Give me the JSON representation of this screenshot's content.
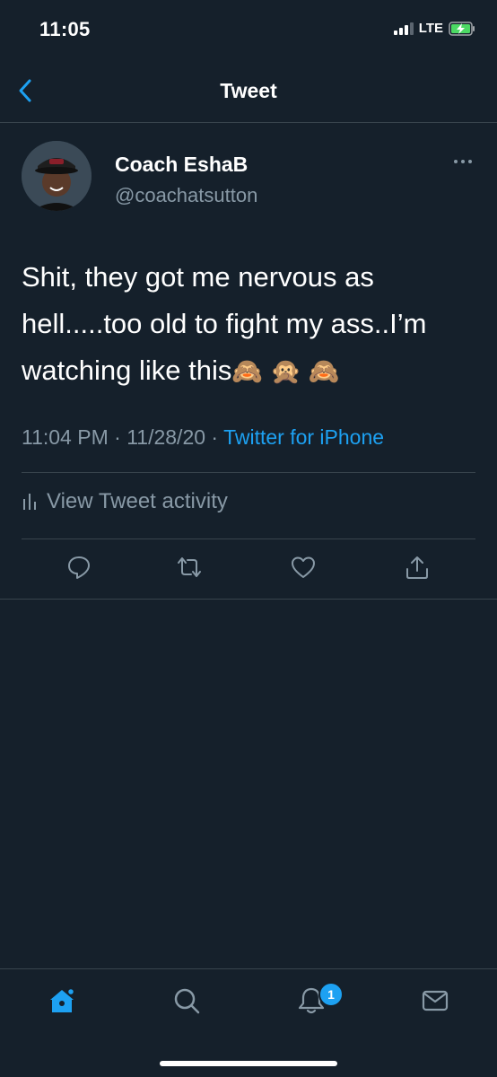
{
  "status_bar": {
    "time": "11:05",
    "network": "LTE"
  },
  "header": {
    "title": "Tweet"
  },
  "tweet": {
    "display_name": "Coach EshaB",
    "handle": "@coachatsutton",
    "text": "Shit, they got me nervous as hell.....too old to fight my ass..I’m watching like this",
    "emojis": "🙈 🙊 🙈",
    "time": "11:04 PM",
    "date": "11/28/20",
    "source": "Twitter for iPhone",
    "separator": "·"
  },
  "activity": {
    "label": "View Tweet activity"
  },
  "actions": {
    "icons": [
      "reply-icon",
      "retweet-icon",
      "like-icon",
      "share-icon"
    ]
  },
  "tab_bar": {
    "icons": [
      "home-icon",
      "search-icon",
      "notifications-icon",
      "messages-icon"
    ],
    "notification_count": "1"
  },
  "colors": {
    "background": "#15202b",
    "accent": "#1da1f2",
    "secondary_text": "#8899a6",
    "divider": "#38444d"
  }
}
